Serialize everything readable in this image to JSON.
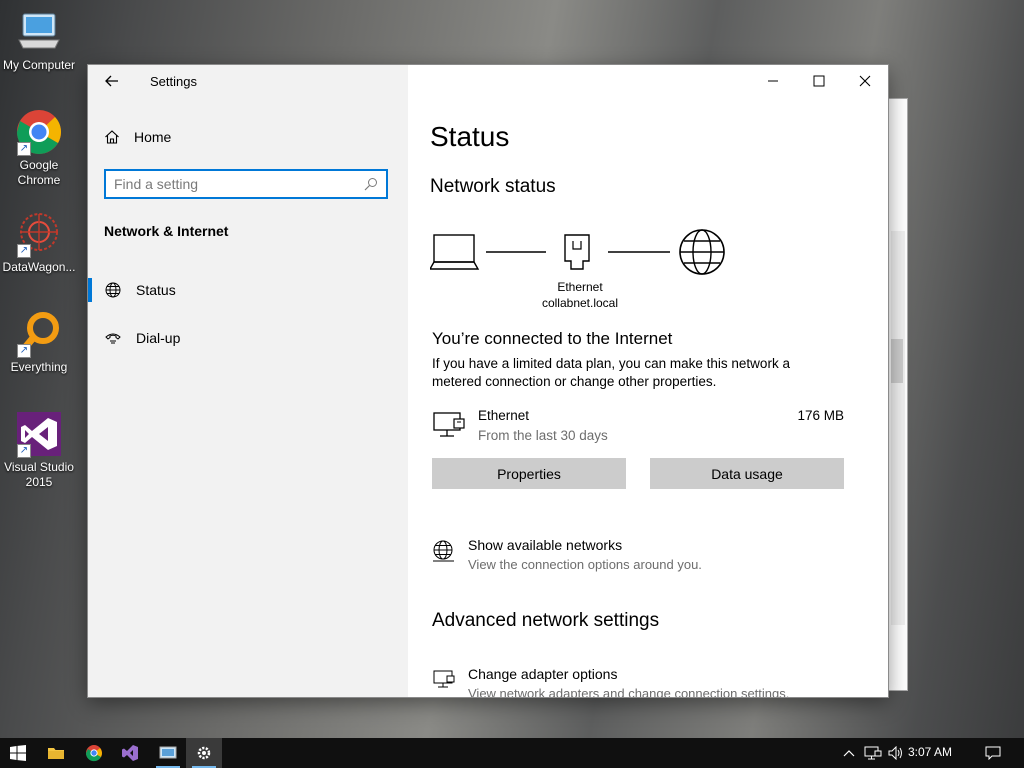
{
  "desktop": {
    "icons": [
      {
        "label": "My Computer",
        "icon": "computer-icon"
      },
      {
        "label": "Google Chrome",
        "icon": "chrome-icon"
      },
      {
        "label": "DataWagon...",
        "icon": "datawagon-icon"
      },
      {
        "label": "Everything",
        "icon": "search-magnifier-icon"
      },
      {
        "label": "Visual Studio 2015",
        "icon": "visual-studio-icon"
      }
    ]
  },
  "window": {
    "title": "Settings",
    "controls": [
      "minimize",
      "maximize",
      "close"
    ]
  },
  "sidebar": {
    "home_label": "Home",
    "search_placeholder": "Find a setting",
    "search_value": "",
    "section_title": "Network & Internet",
    "items": [
      {
        "label": "Status",
        "icon": "globe-icon",
        "active": true
      },
      {
        "label": "Dial-up",
        "icon": "phone-icon",
        "active": false
      }
    ]
  },
  "main": {
    "page_title": "Status",
    "network_status_heading": "Network status",
    "adapter_name": "Ethernet",
    "adapter_domain": "collabnet.local",
    "connected_title": "You’re connected to the Internet",
    "connected_desc": "If you have a limited data plan, you can make this network a metered connection or change other properties.",
    "connection": {
      "name": "Ethernet",
      "period": "From the last 30 days",
      "usage": "176 MB"
    },
    "buttons": {
      "properties": "Properties",
      "data_usage": "Data usage"
    },
    "show_networks": {
      "title": "Show available networks",
      "desc": "View the connection options around you."
    },
    "advanced_heading": "Advanced network settings",
    "change_adapter": {
      "title": "Change adapter options",
      "desc": "View network adapters and change connection settings."
    }
  },
  "taskbar": {
    "clock": "3:07 AM",
    "pinned": [
      "start",
      "file-explorer",
      "chrome",
      "visual-studio",
      "network-tool",
      "settings"
    ]
  },
  "colors": {
    "accent": "#0078d7",
    "button_bg": "#cccccc",
    "sidebar_bg": "#f2f2f2",
    "taskbar_bg": "#101010"
  }
}
